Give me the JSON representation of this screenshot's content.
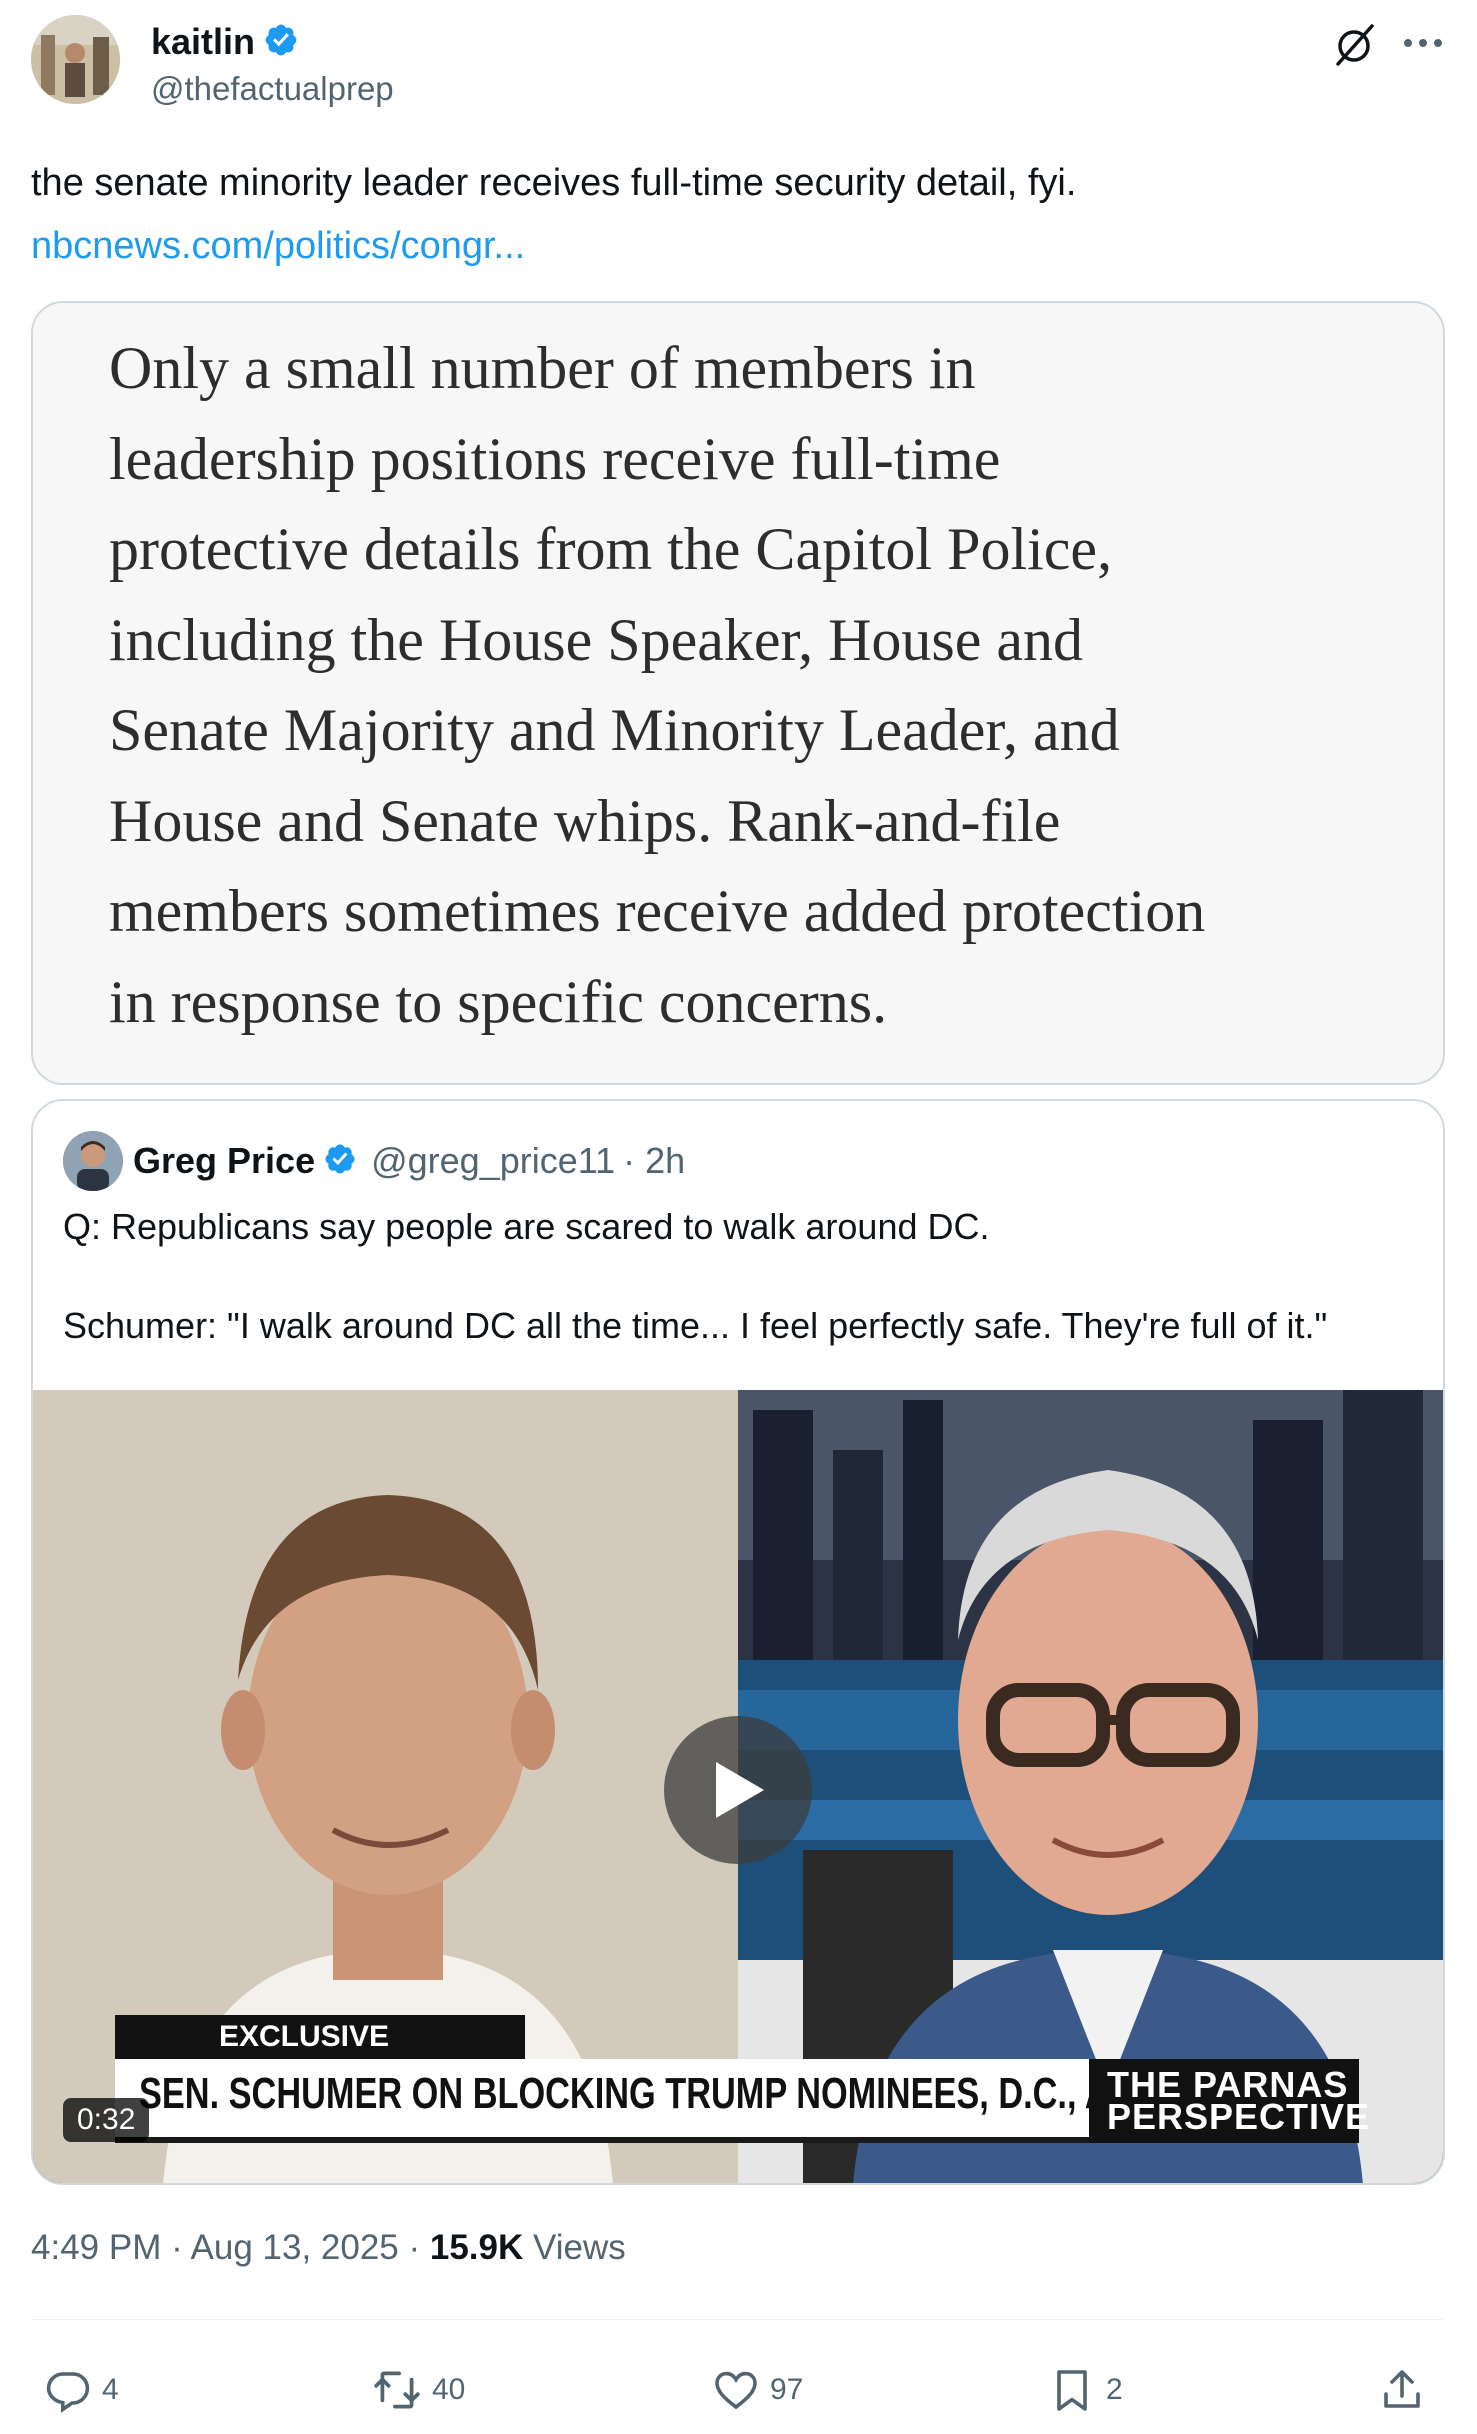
{
  "author": {
    "display_name": "kaitlin",
    "handle": "@thefactualprep",
    "verified": true
  },
  "tweet": {
    "text": "the senate minority leader receives full-time security detail, fyi.",
    "link": "nbcnews.com/politics/congr..."
  },
  "image_quote": {
    "lines": [
      "Only a small number of members in",
      "leadership positions receive full-time",
      "protective details from the Capitol Police,",
      "including the House Speaker, House and",
      "Senate Majority and Minority Leader, and",
      "House and Senate whips. Rank-and-file",
      "members sometimes receive added protection",
      "in response to specific concerns."
    ]
  },
  "quoted_tweet": {
    "display_name": "Greg Price",
    "handle": "@greg_price11",
    "time": "· 2h",
    "line1": "Q: Republicans say people are scared to walk around DC.",
    "line2": "Schumer: \"I walk around DC all the time... I feel perfectly safe. They're full of it.\"",
    "video": {
      "exclusive_label": "EXCLUSIVE",
      "headline": "SEN. SCHUMER ON BLOCKING TRUMP NOMINEES, D.C., AND MORE",
      "show_logo_line1": "THE PARNAS",
      "show_logo_line2": "PERSPECTIVE",
      "duration": "0:32"
    }
  },
  "meta": {
    "time": "4:49 PM · Aug 13, 2025 · ",
    "views_count": "15.9K",
    "views_label": " Views"
  },
  "actions": {
    "replies": "4",
    "reposts": "40",
    "likes": "97",
    "bookmarks": "2"
  },
  "colors": {
    "accent": "#1d9bf0",
    "secondary_text": "#536471",
    "border": "#cfd9de"
  }
}
